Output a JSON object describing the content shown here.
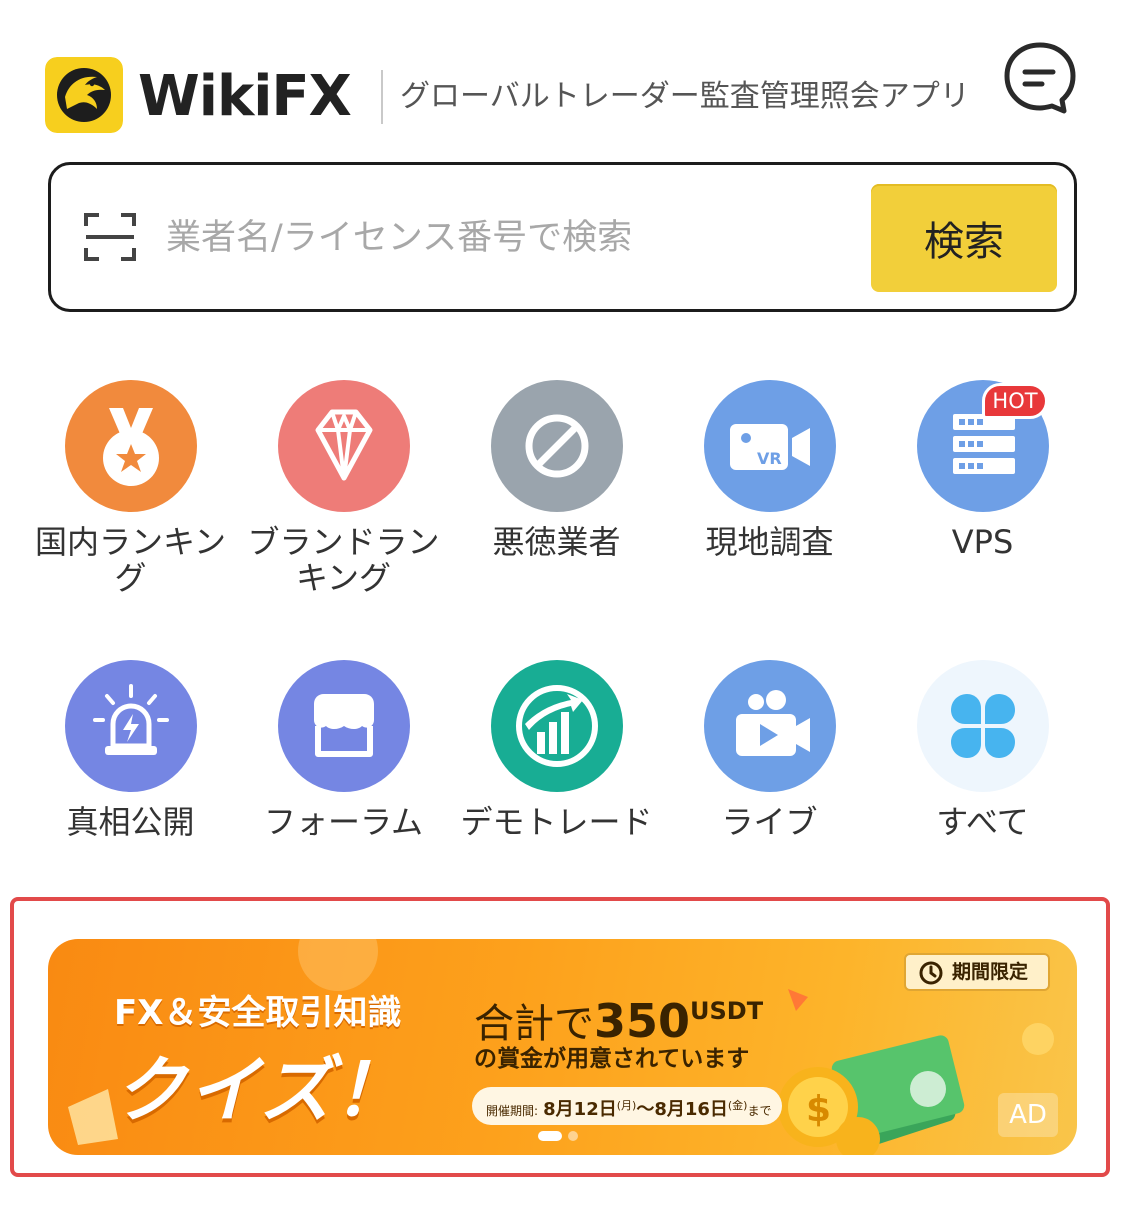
{
  "header": {
    "brand": "WikiFX",
    "tagline": "グローバルトレーダー監査管理照会アプリ",
    "logo_icon": "eagle-logo-icon",
    "chat_icon": "chat-bubble-icon"
  },
  "search": {
    "placeholder": "業者名/ライセンス番号で検索",
    "value": "",
    "button_label": "検索",
    "scan_icon": "scan-icon"
  },
  "features": [
    {
      "label": "国内ランキング",
      "icon": "medal-icon",
      "color": "#f18a3d"
    },
    {
      "label": "ブランドランキング",
      "icon": "diamond-icon",
      "color": "#ee7c78"
    },
    {
      "label": "悪徳業者",
      "icon": "prohibited-icon",
      "color": "#9aa4ad"
    },
    {
      "label": "現地調査",
      "icon": "vr-camera-icon",
      "color": "#6e9fe6"
    },
    {
      "label": "VPS",
      "icon": "server-icon",
      "color": "#6e9fe6",
      "badge": "HOT"
    },
    {
      "label": "真相公開",
      "icon": "alarm-light-icon",
      "color": "#7586e3"
    },
    {
      "label": "フォーラム",
      "icon": "forum-store-icon",
      "color": "#7586e3"
    },
    {
      "label": "デモトレード",
      "icon": "demo-chart-icon",
      "color": "#18ad94"
    },
    {
      "label": "ライブ",
      "icon": "live-video-icon",
      "color": "#6e9fe6"
    },
    {
      "label": "すべて",
      "icon": "all-grid-icon",
      "color": "#47b4ef"
    }
  ],
  "banner": {
    "line1": "FX＆安全取引知識",
    "line2": "クイズ！",
    "total_prefix": "合計で",
    "amount": "350",
    "unit": "USDT",
    "subtitle": "の賞金が用意されています",
    "period_label": "開催期間:",
    "period_start": "8月12日",
    "period_start_day": "(月)",
    "period_sep": "～",
    "period_end": "8月16日",
    "period_end_day": "(金)",
    "period_suffix": "まで",
    "limited": "期間限定",
    "ad": "AD",
    "accent": "#f98a12"
  }
}
